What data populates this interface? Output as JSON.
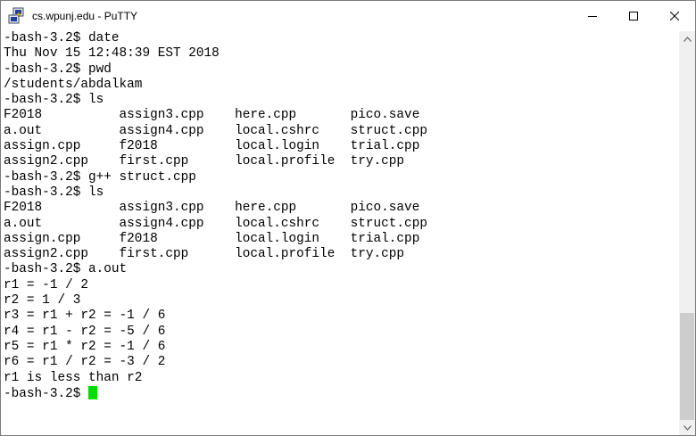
{
  "window": {
    "title": "cs.wpunj.edu - PuTTY",
    "app_icon": "putty-icon",
    "controls": [
      "minimize-icon",
      "maximize-icon",
      "close-icon"
    ]
  },
  "terminal": {
    "cursor_color": "#00dd00",
    "background": "#ffffff",
    "foreground": "#000000",
    "lines": [
      "-bash-3.2$ date",
      "Thu Nov 15 12:48:39 EST 2018",
      "-bash-3.2$ pwd",
      "/students/abdalkam",
      "-bash-3.2$ ls",
      "F2018          assign3.cpp    here.cpp       pico.save",
      "a.out          assign4.cpp    local.cshrc    struct.cpp",
      "assign.cpp     f2018          local.login    trial.cpp",
      "assign2.cpp    first.cpp      local.profile  try.cpp",
      "-bash-3.2$ g++ struct.cpp",
      "-bash-3.2$ ls",
      "F2018          assign3.cpp    here.cpp       pico.save",
      "a.out          assign4.cpp    local.cshrc    struct.cpp",
      "assign.cpp     f2018          local.login    trial.cpp",
      "assign2.cpp    first.cpp      local.profile  try.cpp",
      "-bash-3.2$ a.out",
      "r1 = -1 / 2",
      "r2 = 1 / 3",
      "r3 = r1 + r2 = -1 / 6",
      "r4 = r1 - r2 = -5 / 6",
      "r5 = r1 * r2 = -1 / 6",
      "r6 = r1 / r2 = -3 / 2",
      "r1 is less than r2",
      "-bash-3.2$ "
    ]
  },
  "scrollbar": {
    "up_icon": "chevron-up-icon",
    "down_icon": "chevron-down-icon"
  }
}
